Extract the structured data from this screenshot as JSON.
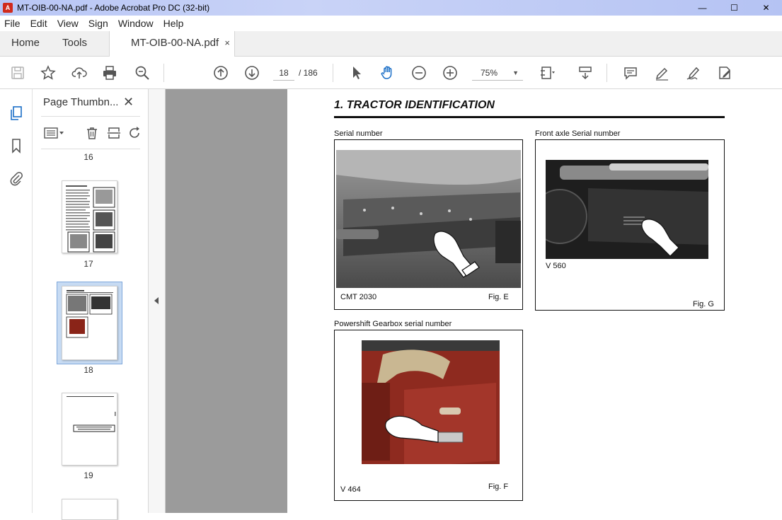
{
  "window": {
    "title": "MT-OIB-00-NA.pdf - Adobe Acrobat Pro DC (32-bit)",
    "controls": {
      "minimize": "—",
      "maximize": "☐",
      "close": "✕"
    }
  },
  "menu": [
    "File",
    "Edit",
    "View",
    "Sign",
    "Window",
    "Help"
  ],
  "tabs": {
    "home": "Home",
    "tools": "Tools",
    "document": "MT-OIB-00-NA.pdf",
    "close": "×"
  },
  "toolbar": {
    "current_page": "18",
    "total_pages": "/ 186",
    "zoom": "75%"
  },
  "sidebar": {
    "header": "Page Thumbn...",
    "close": "✕",
    "thumbnails": [
      {
        "page": "16"
      },
      {
        "page": "17"
      },
      {
        "page": "18",
        "selected": true
      },
      {
        "page": "19"
      }
    ]
  },
  "document": {
    "heading": "1. TRACTOR IDENTIFICATION",
    "figures": [
      {
        "caption": "Serial number",
        "model": "CMT 2030",
        "fig": "Fig. E"
      },
      {
        "caption": "Front axle Serial number",
        "model": "V 560",
        "fig": "Fig. G"
      },
      {
        "caption": "Powershift Gearbox serial number",
        "model": "V 464",
        "fig": "Fig. F"
      }
    ]
  },
  "colors": {
    "titlebar": "#b8c6f5",
    "doc_background": "#9b9b9b",
    "selected_thumb": "#c7dbf3",
    "accent_icon": "#1a6ec7"
  }
}
